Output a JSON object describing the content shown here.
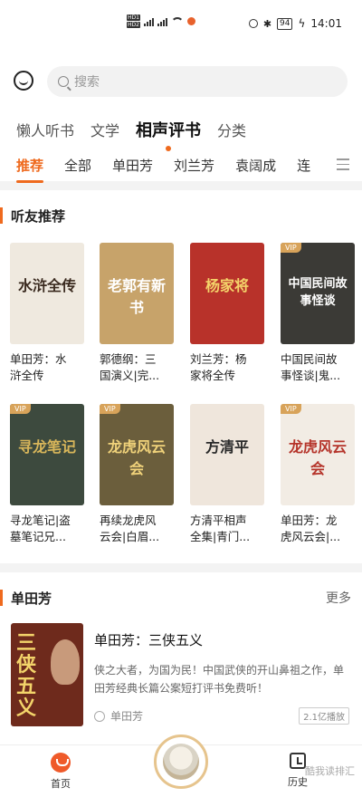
{
  "status_bar": {
    "time": "14:01",
    "battery": "94"
  },
  "search": {
    "placeholder": "搜索"
  },
  "main_tabs": [
    {
      "label": "懒人听书"
    },
    {
      "label": "文学"
    },
    {
      "label": "相声评书",
      "active": true
    },
    {
      "label": "分类"
    }
  ],
  "sub_tabs": [
    {
      "label": "推荐",
      "active": true
    },
    {
      "label": "全部"
    },
    {
      "label": "单田芳"
    },
    {
      "label": "刘兰芳"
    },
    {
      "label": "袁阔成"
    },
    {
      "label": "连"
    }
  ],
  "recommend": {
    "title": "听友推荐",
    "books": [
      {
        "title_line1": "单田芳：水",
        "title_line2": "浒全传",
        "cover_text": "水浒全传",
        "cover_bg": "#efe9df",
        "cover_fg": "#3a2a1f",
        "vip": false
      },
      {
        "title_line1": "郭德纲：三",
        "title_line2": "国演义|完...",
        "cover_text": "老郭有新书",
        "cover_bg": "#c7a36a",
        "cover_fg": "#ffffff",
        "vip": false
      },
      {
        "title_line1": "刘兰芳：杨",
        "title_line2": "家将全传",
        "cover_text": "杨家将",
        "cover_bg": "#b8322a",
        "cover_fg": "#f4d36a",
        "vip": false
      },
      {
        "title_line1": "中国民间故",
        "title_line2": "事怪谈|鬼...",
        "cover_text": "中国民间故事怪谈",
        "cover_bg": "#3b3a36",
        "cover_fg": "#ffffff",
        "vip": true
      },
      {
        "title_line1": "寻龙笔记|盗",
        "title_line2": "墓笔记兄...",
        "cover_text": "寻龙笔记",
        "cover_bg": "#3d4a3e",
        "cover_fg": "#d8b65a",
        "vip": true
      },
      {
        "title_line1": "再续龙虎风",
        "title_line2": "云会|白眉...",
        "cover_text": "龙虎风云会",
        "cover_bg": "#6b5e3c",
        "cover_fg": "#f0d27a",
        "vip": true
      },
      {
        "title_line1": "方清平相声",
        "title_line2": "全集|青门...",
        "cover_text": "方清平",
        "cover_bg": "#efe6dc",
        "cover_fg": "#2a2a2a",
        "vip": false
      },
      {
        "title_line1": "单田芳：龙",
        "title_line2": "虎风云会|...",
        "cover_text": "龙虎风云会",
        "cover_bg": "#f2ece4",
        "cover_fg": "#b5342a",
        "vip": true
      }
    ]
  },
  "section2": {
    "title": "单田芳",
    "more": "更多",
    "book": {
      "title": "单田芳：三侠五义",
      "cover_text": "三侠五义",
      "desc": "侠之大者，为国为民！中国武侠的开山鼻祖之作，单田芳经典长篇公案短打评书免费听！",
      "author": "单田芳",
      "plays": "2.1亿播放"
    }
  },
  "bottom_nav": {
    "home": "首页",
    "history": "历史",
    "watermark": "酷我读排汇"
  },
  "colors": {
    "accent": "#ef6a1e",
    "vip": "#d8a35a"
  }
}
